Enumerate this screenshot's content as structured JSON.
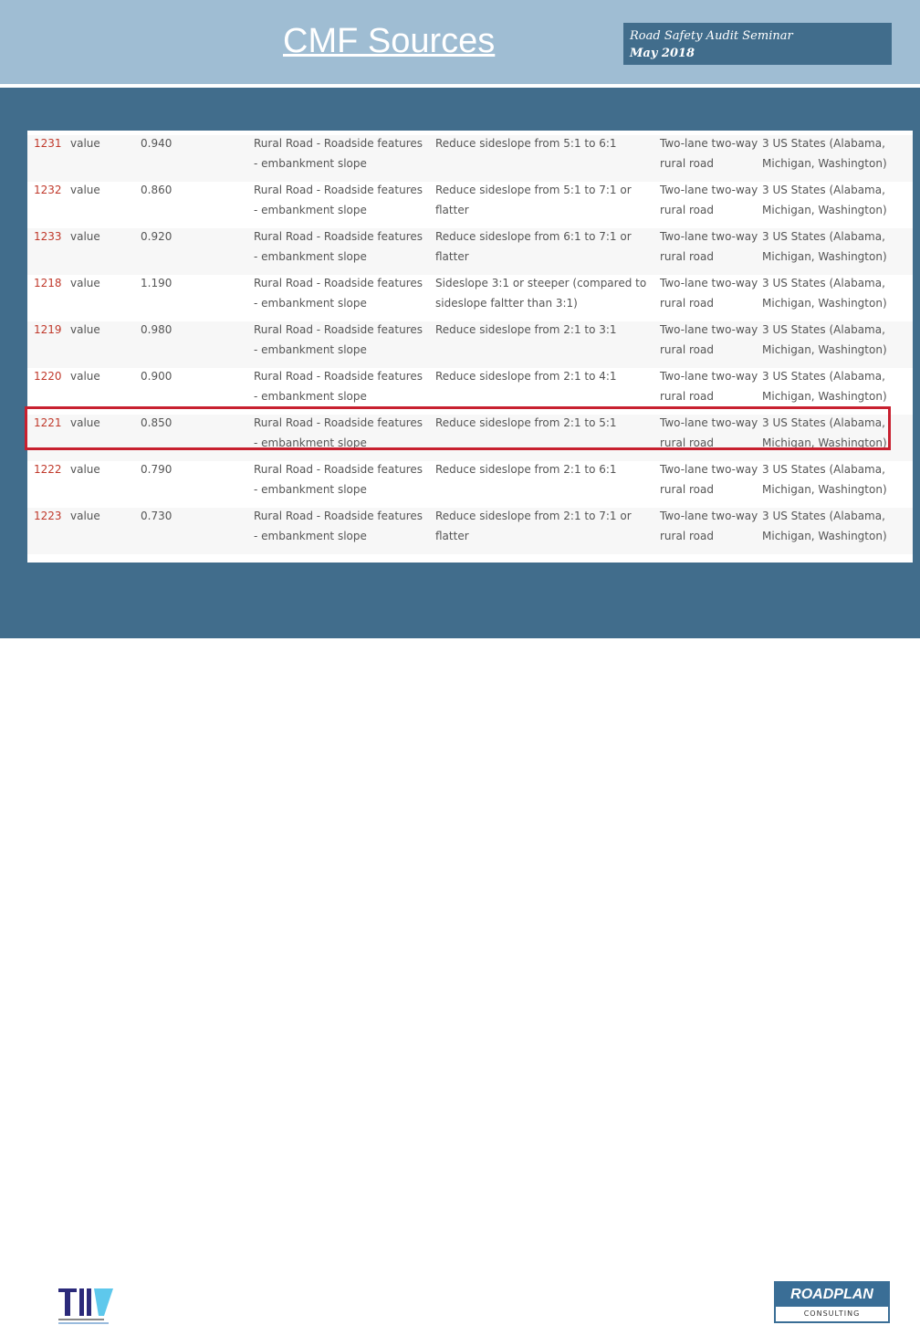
{
  "header": {
    "title": "CMF Sources",
    "seminar": "Road Safety Audit Seminar",
    "date": "May 2018"
  },
  "rows": [
    {
      "id": "1231",
      "label": "value",
      "cmf": "0.940",
      "category": "Rural Road - Roadside features - embankment slope",
      "description": "Reduce sideslope from 5:1 to 6:1",
      "road": "Two-lane two-way rural road",
      "states": "3 US States (Alabama, Michigan, Washington)"
    },
    {
      "id": "1232",
      "label": "value",
      "cmf": "0.860",
      "category": "Rural Road - Roadside features - embankment slope",
      "description": "Reduce sideslope from 5:1 to 7:1 or flatter",
      "road": "Two-lane two-way rural road",
      "states": "3 US States (Alabama, Michigan, Washington)"
    },
    {
      "id": "1233",
      "label": "value",
      "cmf": "0.920",
      "category": "Rural Road - Roadside features - embankment slope",
      "description": "Reduce sideslope from 6:1 to 7:1 or flatter",
      "road": "Two-lane two-way rural road",
      "states": "3 US States (Alabama, Michigan, Washington)"
    },
    {
      "id": "1218",
      "label": "value",
      "cmf": "1.190",
      "category": "Rural Road - Roadside features - embankment slope",
      "description": "Sideslope 3:1 or steeper (compared to sideslope faltter than 3:1)",
      "road": "Two-lane two-way rural road",
      "states": "3 US States (Alabama, Michigan, Washington)"
    },
    {
      "id": "1219",
      "label": "value",
      "cmf": "0.980",
      "category": "Rural Road - Roadside features - embankment slope",
      "description": "Reduce sideslope from 2:1 to 3:1",
      "road": "Two-lane two-way rural road",
      "states": "3 US States (Alabama, Michigan, Washington)"
    },
    {
      "id": "1220",
      "label": "value",
      "cmf": "0.900",
      "category": "Rural Road - Roadside features - embankment slope",
      "description": "Reduce sideslope from 2:1 to 4:1",
      "road": "Two-lane two-way rural road",
      "states": "3 US States (Alabama, Michigan, Washington)"
    },
    {
      "id": "1221",
      "label": "value",
      "cmf": "0.850",
      "category": "Rural Road - Roadside features - embankment slope",
      "description": "Reduce sideslope from 2:1 to 5:1",
      "road": "Two-lane two-way rural road",
      "states": "3 US States (Alabama, Michigan, Washington)"
    },
    {
      "id": "1222",
      "label": "value",
      "cmf": "0.790",
      "category": "Rural Road - Roadside features - embankment slope",
      "description": "Reduce sideslope from 2:1 to 6:1",
      "road": "Two-lane two-way rural road",
      "states": "3 US States (Alabama, Michigan, Washington)"
    },
    {
      "id": "1223",
      "label": "value",
      "cmf": "0.730",
      "category": "Rural Road - Roadside features - embankment slope",
      "description": "Reduce sideslope from 2:1 to 7:1 or flatter",
      "road": "Two-lane two-way rural road",
      "states": "3 US States (Alabama, Michigan, Washington)"
    }
  ],
  "highlighted_id": "1221",
  "logos": {
    "left": "TII",
    "right_top": "ROADPLAN",
    "right_bottom": "CONSULTING"
  },
  "colors": {
    "header": "#9fbdd3",
    "band": "#416d8c",
    "highlight": "#c8202f",
    "id_text": "#c0392b"
  }
}
